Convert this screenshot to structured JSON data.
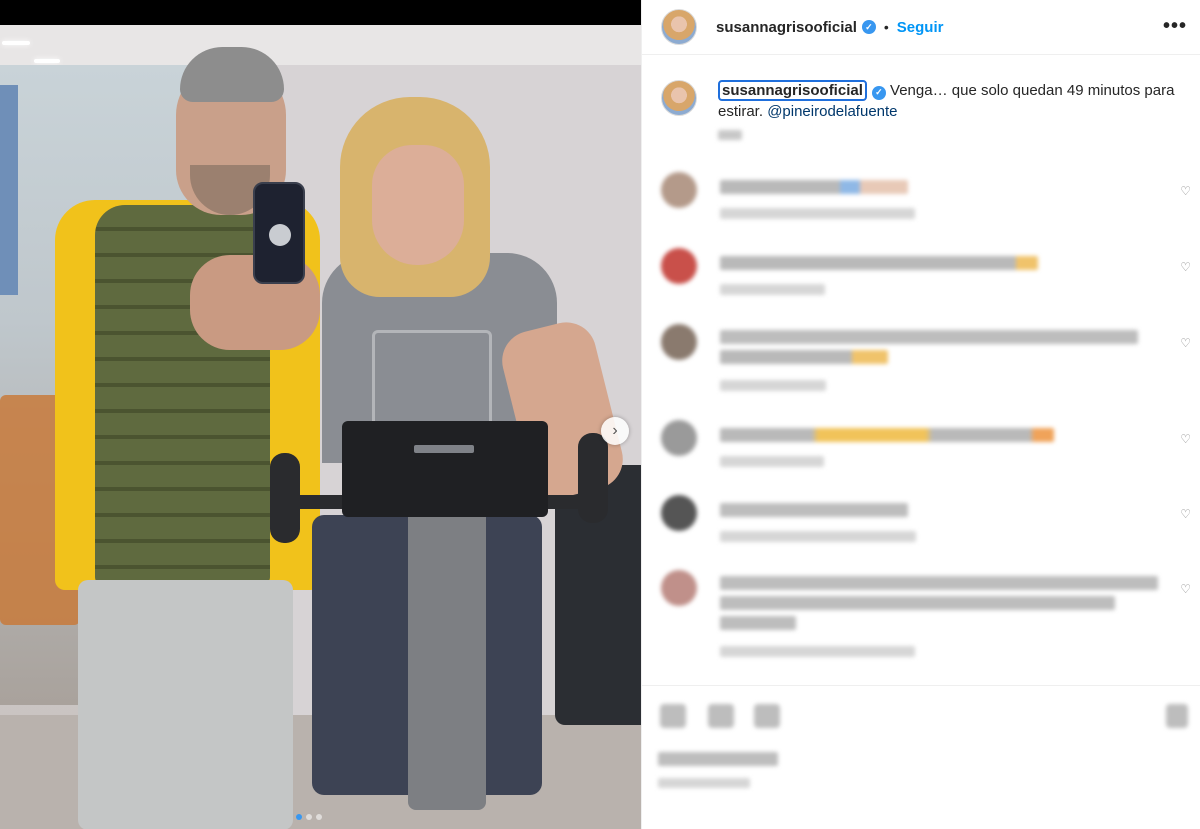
{
  "post": {
    "username": "susannagrisooficial",
    "verified_glyph": "✓",
    "separator": "•",
    "follow_label": "Seguir",
    "more_glyph": "•••"
  },
  "caption": {
    "username": "susannagrisooficial",
    "text": " Venga… que solo quedan 49 minutos para estirar. ",
    "mention": "@pineirodelafuente"
  },
  "carousel": {
    "next_glyph": "›",
    "dots": 3,
    "active_index": 0
  },
  "icons": {
    "verified": "verified-badge-icon",
    "more": "more-options-icon",
    "like": "heart-icon",
    "comment": "comment-icon",
    "share": "share-icon",
    "save": "bookmark-icon",
    "next": "chevron-right-icon"
  },
  "colors": {
    "accent": "#0095f6",
    "verified": "#3897f0",
    "mention": "#00376b",
    "text": "#262626"
  },
  "comments": [
    {
      "heart_glyph": "♡"
    },
    {
      "heart_glyph": "♡"
    },
    {
      "heart_glyph": "♡"
    },
    {
      "heart_glyph": "♡"
    },
    {
      "heart_glyph": "♡"
    },
    {
      "heart_glyph": "♡"
    }
  ]
}
